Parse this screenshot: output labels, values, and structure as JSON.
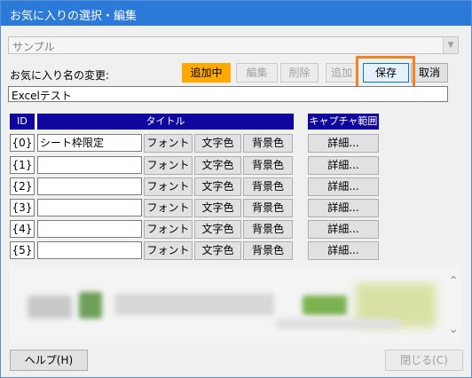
{
  "window": {
    "title": "お気に入りの選択・編集"
  },
  "preset": {
    "value": "サンプル"
  },
  "name_change": {
    "label": "お気に入り名の変更:",
    "value": "Excelテスト"
  },
  "toolbar": {
    "add_label": "追加中",
    "edit_label": "編集",
    "delete_label": "削除",
    "append_label": "追加",
    "save_label": "保存",
    "cancel_label": "取消"
  },
  "table": {
    "headers": {
      "id": "ID",
      "title": "タイトル",
      "capture": "キャプチャ範囲"
    },
    "rows": [
      {
        "id": "{0}",
        "title": "シート枠限定",
        "font": "フォント",
        "text_color": "文字色",
        "bg_color": "背景色",
        "detail": "詳細..."
      },
      {
        "id": "{1}",
        "title": "",
        "font": "フォント",
        "text_color": "文字色",
        "bg_color": "背景色",
        "detail": "詳細..."
      },
      {
        "id": "{2}",
        "title": "",
        "font": "フォント",
        "text_color": "文字色",
        "bg_color": "背景色",
        "detail": "詳細..."
      },
      {
        "id": "{3}",
        "title": "",
        "font": "フォント",
        "text_color": "文字色",
        "bg_color": "背景色",
        "detail": "詳細..."
      },
      {
        "id": "{4}",
        "title": "",
        "font": "フォント",
        "text_color": "文字色",
        "bg_color": "背景色",
        "detail": "詳細..."
      },
      {
        "id": "{5}",
        "title": "",
        "font": "フォント",
        "text_color": "文字色",
        "bg_color": "背景色",
        "detail": "詳細..."
      }
    ]
  },
  "footer": {
    "help_label": "ヘルプ(H)",
    "close_label": "閉じる(C)"
  },
  "colors": {
    "titlebar": "#2b79d8",
    "header": "#10069f",
    "adding": "#ffa800",
    "highlight": "#f5821f"
  },
  "icons": {
    "dropdown": "chevron-down-icon",
    "scroll_up": "scroll-up-icon",
    "scroll_down": "scroll-down-icon"
  }
}
